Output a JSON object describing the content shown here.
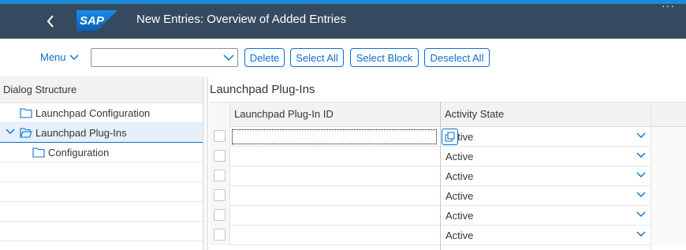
{
  "shell": {
    "title": "New Entries: Overview of Added Entries",
    "logo_text": "SAP",
    "back_icon": "chevron-left-icon",
    "more_icon": "overflow-dots-icon",
    "colors": {
      "shell_bg": "#354a5f",
      "top_strip": "#1d8ad8",
      "logo_blue": "#0a6ed1",
      "accent": "#0a6ed1"
    }
  },
  "toolbar": {
    "menu_label": "Menu",
    "select_value": "",
    "buttons": [
      {
        "label": "Delete"
      },
      {
        "label": "Select All"
      },
      {
        "label": "Select Block"
      },
      {
        "label": "Deselect All"
      }
    ]
  },
  "dialog_structure": {
    "header": "Dialog Structure",
    "items": [
      {
        "label": "Launchpad Configuration",
        "icon": "folder-icon",
        "level": 1,
        "selected": false
      },
      {
        "label": "Launchpad Plug-Ins",
        "icon": "folder-open-icon",
        "level": 1,
        "selected": true,
        "expanded": true
      },
      {
        "label": "Configuration",
        "icon": "folder-icon",
        "level": 2,
        "selected": false
      }
    ]
  },
  "main": {
    "title": "Launchpad Plug-Ins",
    "columns": [
      {
        "label": "Launchpad Plug-In ID"
      },
      {
        "label": "Activity State"
      }
    ],
    "rows": [
      {
        "plugin_id": "",
        "activity_state": "Active",
        "focused": true
      },
      {
        "plugin_id": "",
        "activity_state": "Active"
      },
      {
        "plugin_id": "",
        "activity_state": "Active"
      },
      {
        "plugin_id": "",
        "activity_state": "Active"
      },
      {
        "plugin_id": "",
        "activity_state": "Active"
      },
      {
        "plugin_id": "",
        "activity_state": "Active"
      }
    ]
  }
}
